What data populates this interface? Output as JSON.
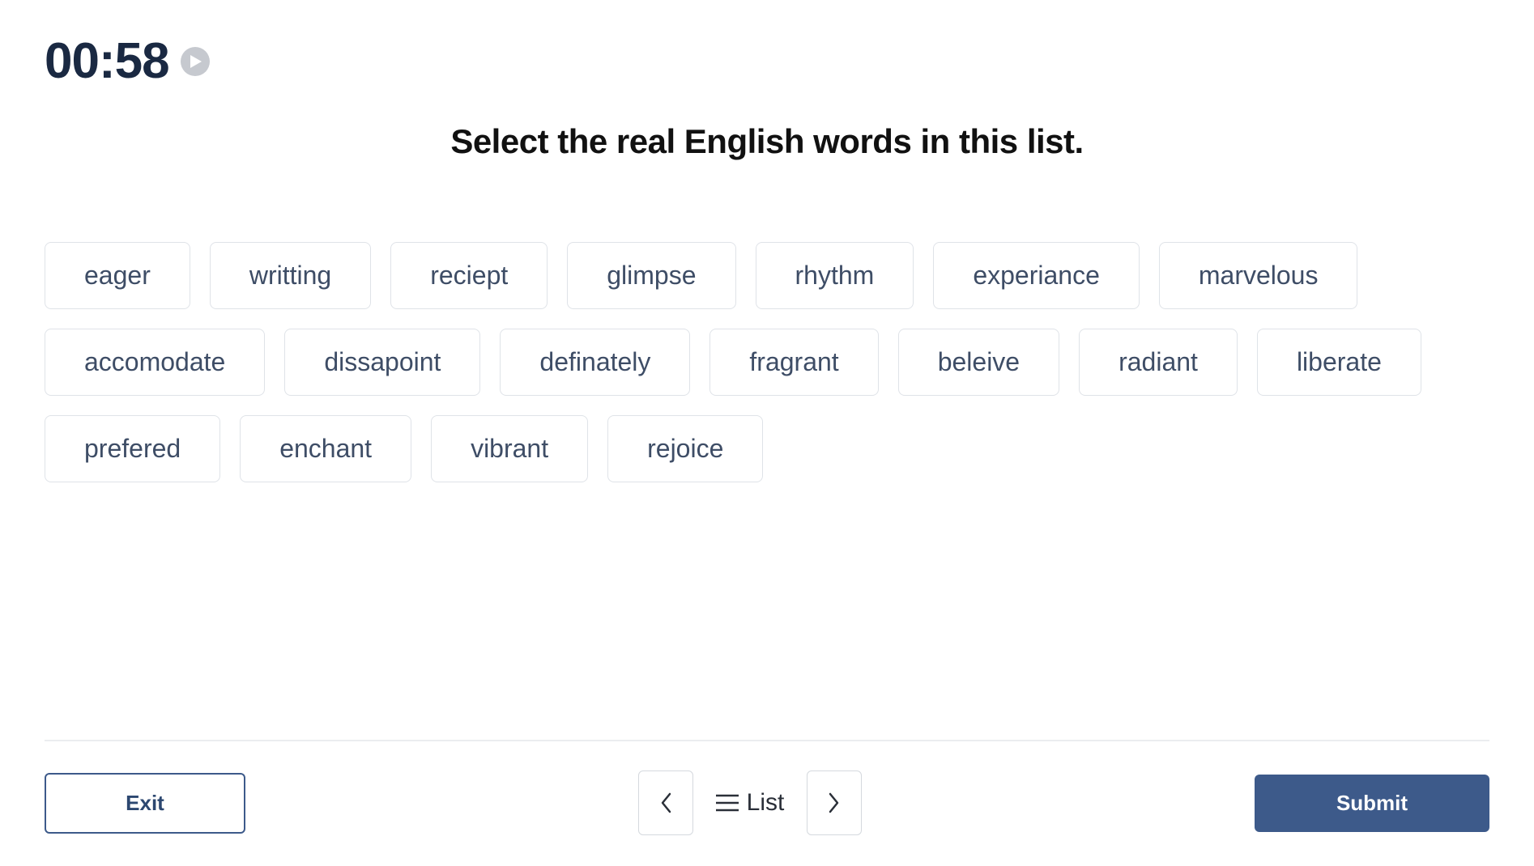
{
  "timer": "00:58",
  "instruction": "Select the real English words in this list.",
  "words": [
    "eager",
    "writting",
    "reciept",
    "glimpse",
    "rhythm",
    "experiance",
    "marvelous",
    "accomodate",
    "dissapoint",
    "definately",
    "fragrant",
    "beleive",
    "radiant",
    "liberate",
    "prefered",
    "enchant",
    "vibrant",
    "rejoice"
  ],
  "footer": {
    "exit_label": "Exit",
    "list_label": "List",
    "submit_label": "Submit"
  }
}
